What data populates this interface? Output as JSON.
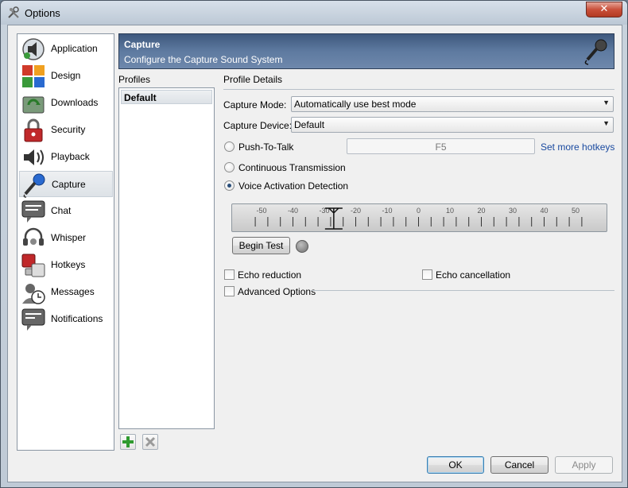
{
  "window": {
    "title": "Options",
    "close_label": "✕"
  },
  "nav": {
    "items": [
      {
        "label": "Application",
        "icon": "speaker-icon"
      },
      {
        "label": "Design",
        "icon": "palette-icon"
      },
      {
        "label": "Downloads",
        "icon": "downloads-icon"
      },
      {
        "label": "Security",
        "icon": "lock-icon"
      },
      {
        "label": "Playback",
        "icon": "playback-icon"
      },
      {
        "label": "Capture",
        "icon": "microphone-icon"
      },
      {
        "label": "Chat",
        "icon": "chat-icon"
      },
      {
        "label": "Whisper",
        "icon": "headset-icon"
      },
      {
        "label": "Hotkeys",
        "icon": "hotkeys-icon"
      },
      {
        "label": "Messages",
        "icon": "messages-icon"
      },
      {
        "label": "Notifications",
        "icon": "notifications-icon"
      }
    ],
    "selected": "Capture"
  },
  "header": {
    "title": "Capture",
    "subtitle": "Configure the Capture Sound System"
  },
  "profiles": {
    "label": "Profiles",
    "items": [
      "Default"
    ],
    "selected": "Default"
  },
  "details": {
    "label": "Profile Details",
    "capture_mode_label": "Capture Mode:",
    "capture_mode_value": "Automatically use best mode",
    "capture_device_label": "Capture Device:",
    "capture_device_value": "Default",
    "push_to_talk_label": "Push-To-Talk",
    "hotkey_value": "F5",
    "set_hotkeys_link": "Set more hotkeys",
    "continuous_label": "Continuous Transmission",
    "vad_label": "Voice Activation Detection",
    "selected_mode": "Voice Activation Detection",
    "meter": {
      "ticks": [
        "-50",
        "-40",
        "-30",
        "-20",
        "-10",
        "0",
        "10",
        "20",
        "30",
        "40",
        "50"
      ],
      "threshold": -27
    },
    "begin_test_label": "Begin Test",
    "echo_reduction_label": "Echo reduction",
    "echo_cancellation_label": "Echo cancellation",
    "advanced_label": "Advanced Options"
  },
  "buttons": {
    "ok": "OK",
    "cancel": "Cancel",
    "apply": "Apply"
  },
  "colors": {
    "header": "#4d6890",
    "link": "#1a4aa0",
    "selection": "#dde2e7"
  }
}
